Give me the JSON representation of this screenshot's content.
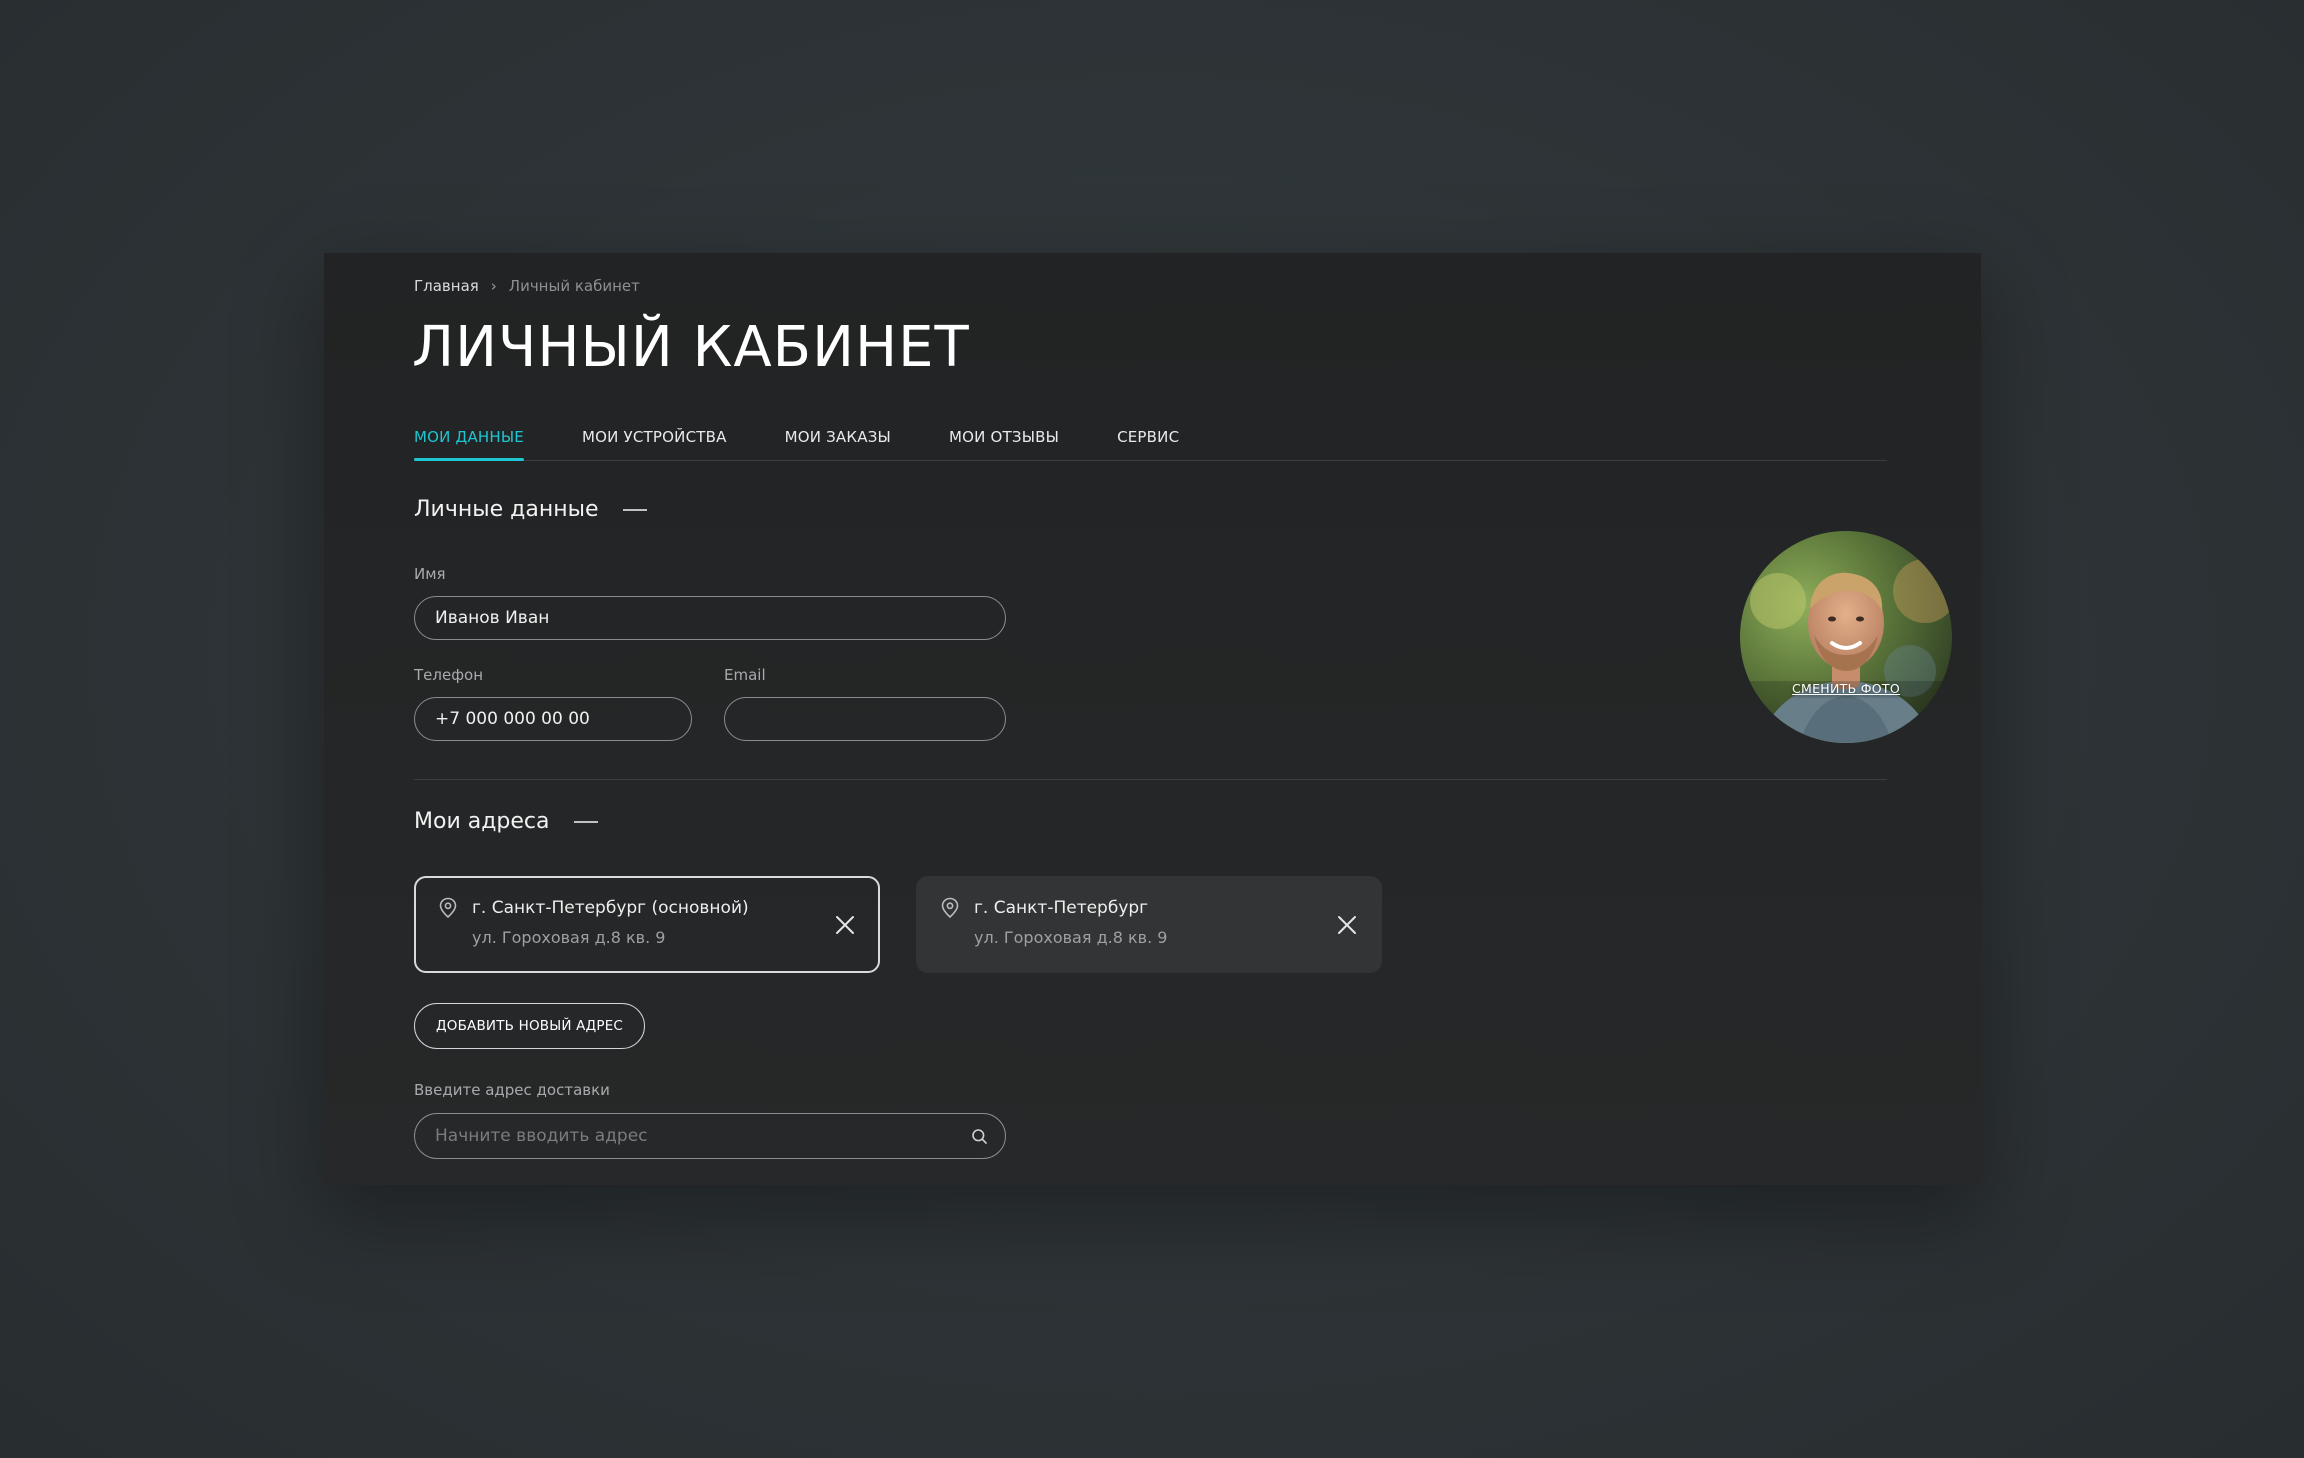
{
  "breadcrumb": {
    "home": "Главная",
    "separator": "›",
    "current": "Личный кабинет"
  },
  "page": {
    "title": "ЛИЧНЫЙ КАБИНЕТ"
  },
  "tabs": [
    {
      "label": "МОИ ДАННЫЕ",
      "active": true
    },
    {
      "label": "МОИ УСТРОЙСТВА",
      "active": false
    },
    {
      "label": "МОИ ЗАКАЗЫ",
      "active": false
    },
    {
      "label": "МОИ ОТЗЫВЫ",
      "active": false
    },
    {
      "label": "СЕРВИС",
      "active": false
    }
  ],
  "personal": {
    "title": "Личные данные",
    "name_label": "Имя",
    "name_value": "Иванов Иван",
    "phone_label": "Телефон",
    "phone_value": "+7 000 000 00 00",
    "email_label": "Email",
    "email_value": "",
    "avatar_action": "СМЕНИТЬ ФОТО"
  },
  "addresses": {
    "title": "Мои адреса",
    "items": [
      {
        "city": "г. Санкт-Петербург (основной)",
        "street": "ул. Гороховая д.8 кв. 9",
        "primary": true
      },
      {
        "city": "г. Санкт-Петербург",
        "street": "ул. Гороховая д.8 кв. 9",
        "primary": false
      }
    ],
    "add_button": "ДОБАВИТЬ НОВЫЙ АДРЕС",
    "search_label": "Введите адрес доставки",
    "search_placeholder": "Начните вводить адрес"
  },
  "colors": {
    "accent": "#1fc6d2",
    "panel_bg": "#232526",
    "page_bg": "#2d3336"
  },
  "icons": {
    "pin": "map-pin-icon",
    "close": "close-icon",
    "search": "search-icon"
  }
}
